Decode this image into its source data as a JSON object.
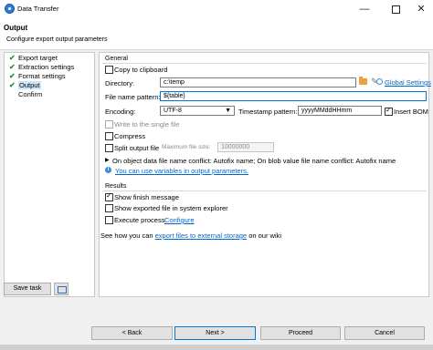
{
  "window": {
    "title": "Data Transfer",
    "controls": {
      "minimize": "—",
      "close": "✕"
    }
  },
  "header": {
    "title": "Output",
    "subtitle": "Configure export output parameters"
  },
  "nav": {
    "items": [
      {
        "label": "Export target",
        "done": true,
        "check": "✔"
      },
      {
        "label": "Extraction settings",
        "done": true,
        "check": "✔"
      },
      {
        "label": "Format settings",
        "done": true,
        "check": "✔"
      },
      {
        "label": "Output",
        "done": true,
        "check": "✔",
        "active": true
      },
      {
        "label": "Confirm",
        "done": false,
        "check": ""
      }
    ],
    "save_task_label": "Save task"
  },
  "general": {
    "group_label": "General",
    "copy_to_clipboard": {
      "label": "Copy to clipboard",
      "checked": false
    },
    "directory": {
      "label": "Directory:",
      "value": "c:\\temp",
      "global_settings_link": "Global Settings"
    },
    "file_name_pattern": {
      "label": "File name pattern:",
      "value": "${table}"
    },
    "encoding": {
      "label": "Encoding:",
      "value": "UTF-8",
      "arrow": "▼"
    },
    "timestamp_pattern": {
      "label": "Timestamp pattern:",
      "value": "yyyyMMddHHmm"
    },
    "insert_bom": {
      "label": "Insert BOM",
      "checked": true
    },
    "write_single_file": {
      "label": "Write to the single file",
      "checked": false,
      "disabled": true
    },
    "compress": {
      "label": "Compress",
      "checked": false
    },
    "split_output": {
      "label": "Split output file",
      "checked": false
    },
    "max_file_size": {
      "label": "Maximum file size:",
      "value": "10000000"
    },
    "conflict_text": "On object data file name conflict: Autofix name; On blob value file name conflict: Autofix name",
    "expand_arrow": "▶",
    "info_glyph": "i",
    "variables_link": "You can use variables in output parameters."
  },
  "results": {
    "group_label": "Results",
    "show_finish_message": {
      "label": "Show finish message",
      "checked": true
    },
    "show_exported_file": {
      "label": "Show exported file in system explorer",
      "checked": false
    },
    "execute_process": {
      "label": "Execute process",
      "checked": false,
      "configure_link": "Configure"
    }
  },
  "footer_note": {
    "prefix": "See how you can ",
    "link": "export files to external storage",
    "suffix": " on our wiki"
  },
  "buttons": {
    "back": "< Back",
    "next": "Next >",
    "proceed": "Proceed",
    "cancel": "Cancel"
  },
  "colors": {
    "accent": "#0078d7",
    "link": "#0066cc",
    "check_green": "#2e8b32",
    "folder": "#e9a23b"
  },
  "icons": [
    "app-icon",
    "minimize-icon",
    "maximize-icon",
    "close-icon",
    "check-icon",
    "task-config-icon",
    "folder-icon",
    "pencil-icon",
    "globe-icon",
    "info-icon",
    "chevron-down-icon"
  ]
}
